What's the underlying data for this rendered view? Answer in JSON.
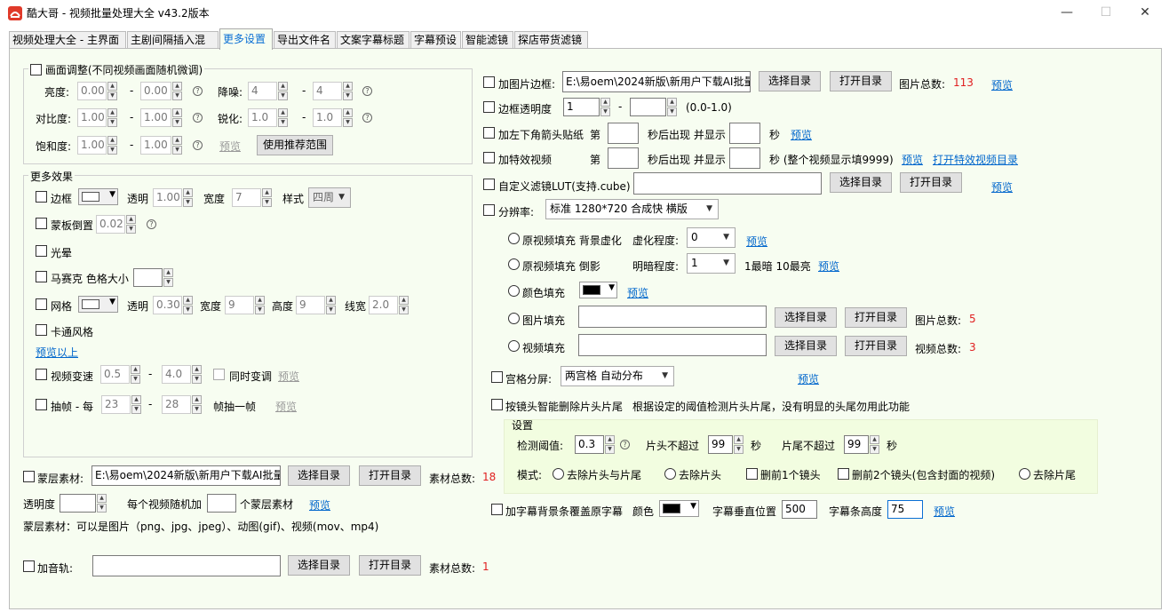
{
  "window": {
    "title": "酷大哥 - 视频批量处理大全  v43.2版本",
    "minimize": "—",
    "maximize": "☐",
    "close": "✕"
  },
  "tabs": [
    "视频处理大全 - 主界面",
    "主剧间隔插入混剪",
    "更多设置",
    "导出文件名",
    "文案字幕标题",
    "字幕预设",
    "智能滤镜",
    "探店带货滤镜"
  ],
  "active_tab": 2,
  "picture_adjust": {
    "label": "画面调整(不同视频画面随机微调)",
    "brightness": {
      "label": "亮度:",
      "min": "0.00",
      "max": "0.00"
    },
    "denoise": {
      "label": "降噪:",
      "min": "4",
      "max": "4"
    },
    "contrast": {
      "label": "对比度:",
      "min": "1.00",
      "max": "1.00"
    },
    "sharpen": {
      "label": "锐化:",
      "min": "1.0",
      "max": "1.0"
    },
    "saturation": {
      "label": "饱和度:",
      "min": "1.00",
      "max": "1.00"
    },
    "dash": "-",
    "preview": "预览",
    "recommend": "使用推荐范围"
  },
  "more_effects": {
    "label": "更多效果",
    "border": {
      "label": "边框",
      "opacity_label": "透明",
      "opacity": "1.00",
      "width_label": "宽度",
      "width": "7",
      "style_label": "样式",
      "style": "四周"
    },
    "mask_flip": {
      "label": "蒙板倒置",
      "value": "0.02"
    },
    "halo": {
      "label": "光晕"
    },
    "mosaic": {
      "label": "马赛克 色格大小",
      "value": ""
    },
    "grid": {
      "label": "网格",
      "opacity_label": "透明",
      "opacity": "0.30",
      "width_label": "宽度",
      "width": "9",
      "height_label": "高度",
      "height": "9",
      "line_label": "线宽",
      "line": "2.0"
    },
    "cartoon": {
      "label": "卡通风格"
    },
    "preview_above": "预览以上",
    "speed": {
      "label": "视频变速",
      "min": "0.5",
      "max": "4.0",
      "sync": "同时变调",
      "preview": "预览"
    },
    "frame_drop": {
      "label": "抽帧 - 每",
      "min": "23",
      "max": "28",
      "suffix": "帧抽一帧",
      "preview": "预览"
    }
  },
  "mask_material": {
    "label": "蒙层素材:",
    "path": "E:\\易oem\\2024新版\\新用户下载AI批量",
    "browse": "选择目录",
    "open": "打开目录",
    "count_label": "素材总数:",
    "count": "18",
    "opacity_label": "透明度",
    "opacity": "",
    "per_video": "每个视频随机加",
    "per_value": "",
    "per_suffix": "个蒙层素材",
    "preview": "预览",
    "note": "蒙层素材：可以是图片（png、jpg、jpeg）、动图(gif)、视频(mov、mp4)"
  },
  "audio": {
    "label": "加音轨:",
    "path": "",
    "browse": "选择目录",
    "open": "打开目录",
    "count_label": "素材总数:",
    "count": "1"
  },
  "right": {
    "pic_border": {
      "label": "加图片边框:",
      "path": "E:\\易oem\\2024新版\\新用户下载AI批量",
      "browse": "选择目录",
      "open": "打开目录",
      "count_label": "图片总数:",
      "count": "113",
      "preview": "预览"
    },
    "border_opacity": {
      "label": "边框透明度",
      "min": "1",
      "max": "",
      "range": "(0.0-1.0)"
    },
    "sticker": {
      "label": "加左下角箭头贴纸",
      "p1": "第",
      "p2": "秒后出现 并显示",
      "p3": "秒",
      "preview": "预览"
    },
    "effect_video": {
      "label": "加特效视频",
      "p1": "第",
      "p2": "秒后出现 并显示",
      "p3": "秒 (整个视频显示填9999)",
      "preview": "预览",
      "open": "打开特效视频目录"
    },
    "lut": {
      "label": "自定义滤镜LUT(支持.cube)",
      "path": "",
      "browse": "选择目录",
      "open": "打开目录",
      "preview": "预览"
    },
    "resolution": {
      "label": "分辨率:",
      "value": "标准 1280*720 合成快 横版"
    },
    "fill_blur": {
      "label": "原视频填充 背景虚化",
      "deg_label": "虚化程度:",
      "deg": "0",
      "preview": "预览"
    },
    "fill_invert": {
      "label": "原视频填充 倒影",
      "deg_label": "明暗程度:",
      "deg": "1",
      "hint": "1最暗 10最亮",
      "preview": "预览"
    },
    "fill_color": {
      "label": "颜色填充",
      "color": "#000000",
      "preview": "预览"
    },
    "fill_image": {
      "label": "图片填充",
      "browse": "选择目录",
      "open": "打开目录",
      "count_label": "图片总数:",
      "count": "5"
    },
    "fill_video": {
      "label": "视频填充",
      "browse": "选择目录",
      "open": "打开目录",
      "count_label": "视频总数:",
      "count": "3"
    },
    "split_screen": {
      "label": "宫格分屏:",
      "value": "两宫格 自动分布",
      "preview": "预览"
    },
    "shot_trim": {
      "label": "按镜头智能删除片头片尾",
      "desc": "根据设定的阈值检测片头片尾，没有明显的头尾勿用此功能"
    },
    "settings": {
      "legend": "设置",
      "threshold_label": "检测阈值:",
      "threshold": "0.3",
      "head_label": "片头不超过",
      "head": "99",
      "tail_label": "片尾不超过",
      "tail": "99",
      "sec": "秒",
      "mode_label": "模式:",
      "modes": [
        "去除片头与片尾",
        "去除片头",
        "删前1个镜头",
        "删前2个镜头(包含封面的视频)",
        "去除片尾"
      ]
    },
    "subtitle_bg": {
      "label": "加字幕背景条覆盖原字幕",
      "color_label": "颜色",
      "color": "#000000",
      "vpos_label": "字幕垂直位置",
      "vpos": "500",
      "height_label": "字幕条高度",
      "height": "75",
      "preview": "预览"
    }
  }
}
